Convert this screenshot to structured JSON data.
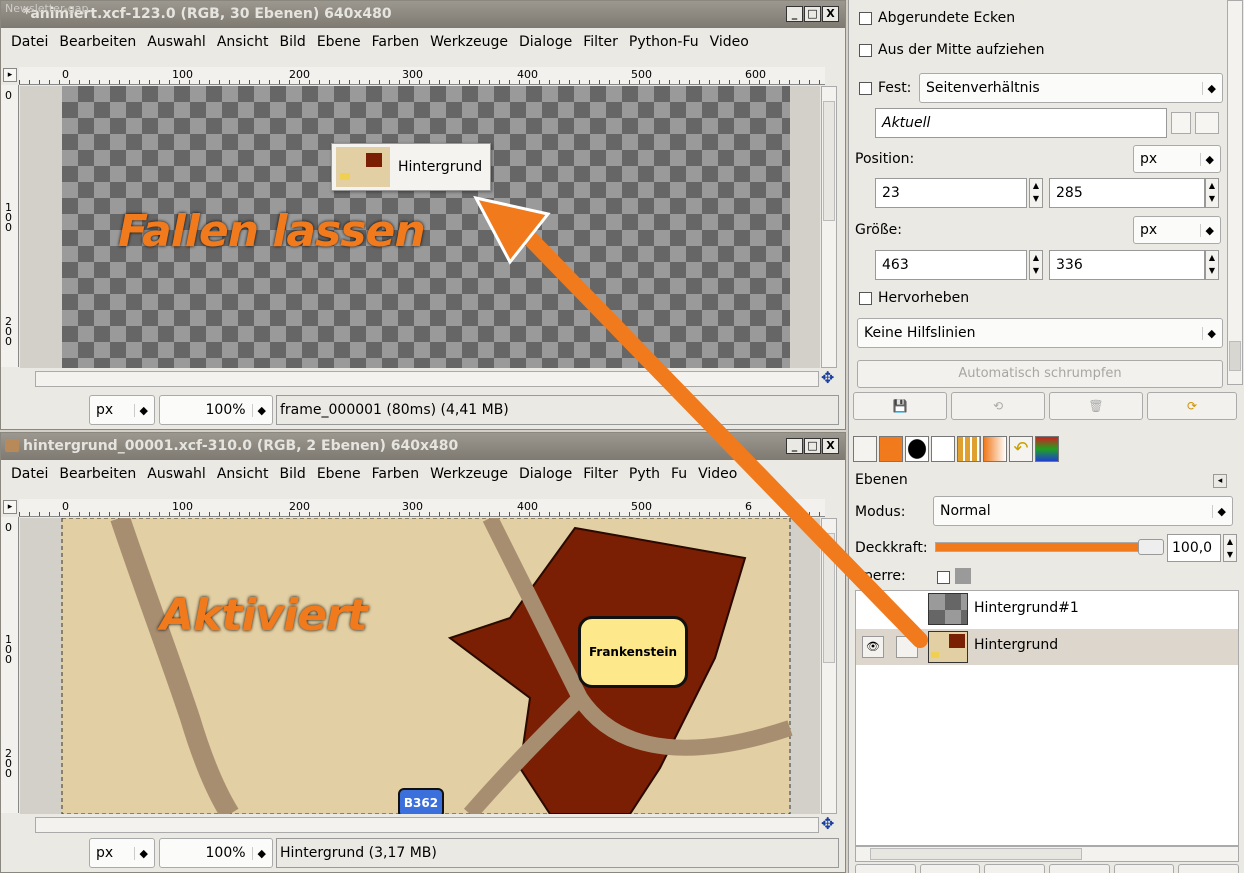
{
  "top_window": {
    "ghost_title": "Newsletter-gap",
    "title": "*animiert.xcf-123.0 (RGB, 30 Ebenen) 640x480",
    "win_buttons": [
      "_",
      "□",
      "X"
    ],
    "menu": [
      "Datei",
      "Bearbeiten",
      "Auswahl",
      "Ansicht",
      "Bild",
      "Ebene",
      "Farben",
      "Werkzeuge",
      "Dialoge",
      "Filter",
      "Python-Fu",
      "Video"
    ],
    "ruler_labels": [
      "0",
      "100",
      "200",
      "300",
      "400",
      "500",
      "600"
    ],
    "vruler_labels": [
      "0",
      "100",
      "200"
    ],
    "status": {
      "unit": "px",
      "zoom": "100%",
      "info": "frame_000001 (80ms) (4,41 MB)"
    },
    "drag_tooltip": "Hintergrund",
    "overlay_text": "Fallen lassen"
  },
  "bottom_window": {
    "title": "hintergrund_00001.xcf-310.0 (RGB, 2 Ebenen) 640x480",
    "win_buttons": [
      "_",
      "□",
      "X"
    ],
    "menu": [
      "Datei",
      "Bearbeiten",
      "Auswahl",
      "Ansicht",
      "Bild",
      "Ebene",
      "Farben",
      "Werkzeuge",
      "Dialoge",
      "Filter",
      "Pyth",
      "Fu",
      "Video"
    ],
    "ruler_labels": [
      "0",
      "100",
      "200",
      "300",
      "400",
      "500",
      "6"
    ],
    "vruler_labels": [
      "0",
      "100",
      "200"
    ],
    "status": {
      "unit": "px",
      "zoom": "100%",
      "info": "Hintergrund (3,17 MB)"
    },
    "overlay_text": "Aktiviert",
    "map_label": "Frankenstein",
    "road_badge": "B362"
  },
  "tool_options": {
    "rounded_corners": "Abgerundete Ecken",
    "from_center": "Aus der Mitte aufziehen",
    "fixed_label": "Fest:",
    "fixed_value": "Seitenverhältnis",
    "aspect_value": "Aktuell",
    "position_label": "Position:",
    "position_unit": "px",
    "pos_x": "23",
    "pos_y": "285",
    "size_label": "Größe:",
    "size_unit": "px",
    "size_w": "463",
    "size_h": "336",
    "highlight": "Hervorheben",
    "guides": "Keine Hilfslinien",
    "auto_shrink": "Automatisch schrumpfen"
  },
  "layers": {
    "title": "Ebenen",
    "mode_label": "Modus:",
    "mode_value": "Normal",
    "opacity_label": "Deckkraft:",
    "opacity_value": "100,0",
    "opacity": 1.0,
    "lock_label": "Sperre:",
    "items": [
      {
        "name": "Hintergrund#1"
      },
      {
        "name": "Hintergrund"
      }
    ]
  },
  "colors": {
    "orange": "#f07a1c",
    "dark_red": "#7a1e04",
    "sand": "#e2cfa3",
    "road": "#a88e70",
    "sign": "#fde98c",
    "badge": "#3b6fdb"
  }
}
